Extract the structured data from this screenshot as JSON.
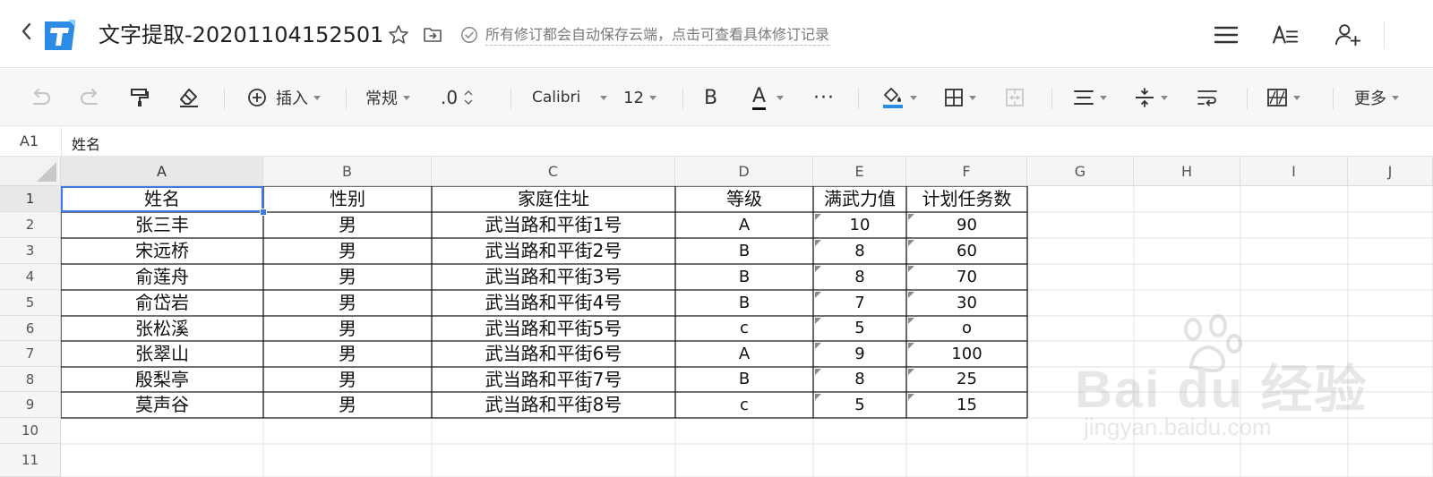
{
  "titlebar": {
    "doc_title": "文字提取-20201104152501",
    "save_status": "所有修订都会自动保存云端，点击可查看具体修订记录",
    "icons": [
      "back-icon",
      "app-logo",
      "star-icon",
      "move-to-folder-icon",
      "cloud-saved-check-icon",
      "menu-icon",
      "text-style-icon",
      "add-collaborator-icon"
    ]
  },
  "toolbar": {
    "insert_label": "插入",
    "format_label": "常规",
    "decimal_label": ".0",
    "font_name": "Calibri",
    "font_size": "12",
    "bold_label": "B",
    "font_color_label": "A",
    "more_dots": "···",
    "more_label": "更多",
    "accent_color": "#2b8ce6",
    "font_color": "#111111"
  },
  "formula_bar": {
    "cell_ref": "A1",
    "value": "姓名"
  },
  "sheet": {
    "columns": [
      "A",
      "B",
      "C",
      "D",
      "E",
      "F",
      "G",
      "H",
      "I",
      "J"
    ],
    "row_numbers": [
      "1",
      "2",
      "3",
      "4",
      "5",
      "6",
      "7",
      "8",
      "9",
      "10",
      "11"
    ],
    "headers": [
      "姓名",
      "性别",
      "家庭住址",
      "等级",
      "满武力值",
      "计划任务数"
    ],
    "rows": [
      [
        "张三丰",
        "男",
        "武当路和平街1号",
        "A",
        "10",
        "90"
      ],
      [
        "宋远桥",
        "男",
        "武当路和平街2号",
        "B",
        "8",
        "60"
      ],
      [
        "俞莲舟",
        "男",
        "武当路和平街3号",
        "B",
        "8",
        "70"
      ],
      [
        "俞岱岩",
        "男",
        "武当路和平街4号",
        "B",
        "7",
        "30"
      ],
      [
        "张松溪",
        "男",
        "武当路和平街5号",
        "c",
        "5",
        "o"
      ],
      [
        "张翠山",
        "男",
        "武当路和平街6号",
        "A",
        "9",
        "100"
      ],
      [
        "殷梨亭",
        "男",
        "武当路和平街7号",
        "B",
        "8",
        "25"
      ],
      [
        "莫声谷",
        "男",
        "武当路和平街8号",
        "c",
        "5",
        "15"
      ]
    ],
    "selected_cell": "A1",
    "selection_color": "#3e7ae6"
  },
  "watermark": {
    "brand": "Bai du 经验",
    "url": "jingyan.baidu.com"
  }
}
